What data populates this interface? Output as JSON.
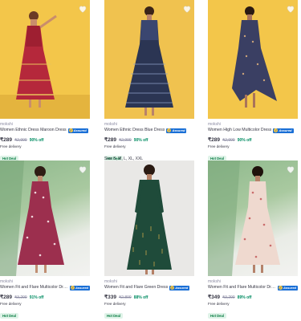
{
  "products": [
    {
      "brand": "mokshi",
      "title": "Women Ethnic Dress Maroon Dress",
      "assured": "Assured",
      "price": "₹289",
      "mrp": "₹2,999",
      "discount": "90% off",
      "delivery": "Free delivery",
      "hot_deal": "Hot Deal",
      "bg": "#f3c64a",
      "dress_color": "#b5283b"
    },
    {
      "brand": "mokshi",
      "title": "Women Ethnic Dress Blue Dress",
      "assured": "Assured",
      "price": "₹289",
      "mrp": "₹2,999",
      "discount": "90% off",
      "delivery": "Free delivery",
      "hot_deal": "Hot Deal",
      "bg": "#f0c24f",
      "dress_color": "#2b3553"
    },
    {
      "brand": "mokshi",
      "title": "Women High Low Multicolor Dress",
      "assured": "Assured",
      "price": "₹289",
      "mrp": "₹2,999",
      "discount": "90% off",
      "delivery": "Free delivery",
      "hot_deal": "Hot Deal",
      "bg": "#f3c64a",
      "dress_color": "#3a3f63"
    },
    {
      "brand": "mokshi",
      "title": "Women Fit and Flare Multicolor Dress",
      "assured": "Assured",
      "price": "₹289",
      "mrp": "₹3,299",
      "discount": "91% off",
      "delivery": "Free delivery",
      "hot_deal": "Hot Deal",
      "bg": "#a9c9a0",
      "dress_color": "#9c2f4e"
    },
    {
      "sizes": "Size S, M, L, XL, XXL",
      "brand": "mokshi",
      "title": "Women Fit and Flare Green Dress",
      "assured": "Assured",
      "price": "₹339",
      "mrp": "₹2,899",
      "discount": "88% off",
      "delivery": "Free delivery",
      "hot_deal": "Hot Deal",
      "bg": "#e9e8e6",
      "dress_color": "#1f4b3a"
    },
    {
      "brand": "mokshi",
      "title": "Women Fit and Flare Multicolor Dress",
      "assured": "Assured",
      "price": "₹349",
      "mrp": "₹3,299",
      "discount": "89% off",
      "delivery": "Free delivery",
      "hot_deal": "Hot Deal",
      "bg": "#a9c9a0",
      "dress_color": "#efd9cf"
    }
  ]
}
